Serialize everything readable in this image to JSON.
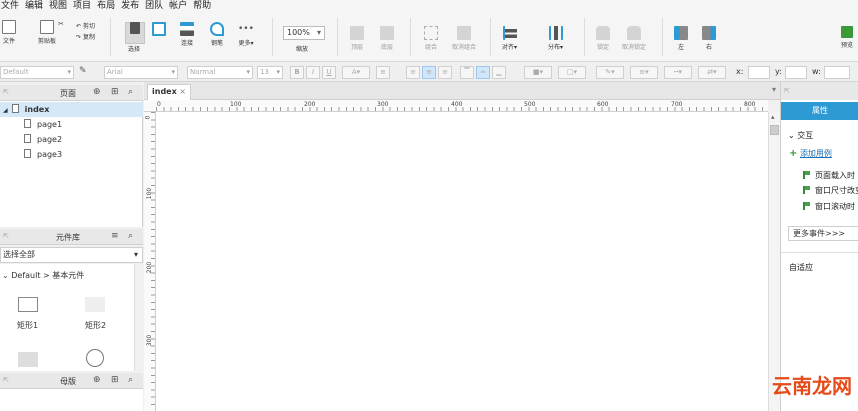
{
  "menu": [
    "文件",
    "编辑",
    "视图",
    "项目",
    "布局",
    "发布",
    "团队",
    "帐户",
    "帮助"
  ],
  "toolbar": {
    "file": "文件",
    "clipboard": "剪贴板",
    "cut": "剪切",
    "copy": "复制",
    "select": "选择",
    "connect": "连接",
    "pen": "钢笔",
    "more": "更多▾",
    "zoom_value": "100%",
    "zoom_label": "缩放",
    "top": "顶层",
    "bottom": "底层",
    "group": "组合",
    "ungroup": "取消组合",
    "align": "对齐▾",
    "distribute": "分布▾",
    "lock": "锁定",
    "unlock": "取消锁定",
    "left": "左",
    "right": "右",
    "preview": "预览"
  },
  "format": {
    "style": "Default",
    "font": "Arial",
    "weight": "Normal",
    "size": "13",
    "x_label": "x:",
    "y_label": "y:",
    "w_label": "w:"
  },
  "pages_panel": {
    "title": "页面",
    "items": [
      "index",
      "page1",
      "page2",
      "page3"
    ]
  },
  "library_panel": {
    "title": "元件库",
    "select": "选择全部",
    "path": "Default > 基本元件",
    "widgets": [
      "矩形1",
      "矩形2"
    ]
  },
  "master_panel": {
    "title": "母版"
  },
  "canvas": {
    "tab": "index",
    "hruler": [
      "0",
      "100",
      "200",
      "300",
      "400",
      "500",
      "600",
      "700",
      "800"
    ],
    "vruler": [
      "0",
      "100",
      "200",
      "300"
    ]
  },
  "right_panel": {
    "tab": "属性",
    "interaction": "交互",
    "add_case": "添加用例",
    "events": [
      "页面载入时",
      "窗口尺寸改变时",
      "窗口滚动时"
    ],
    "more_events": "更多事件>>>",
    "adaptive": "自适应"
  },
  "watermark": "云南龙网",
  "colors": {
    "accent": "#2e9ad4",
    "green": "#3a9a3a"
  }
}
